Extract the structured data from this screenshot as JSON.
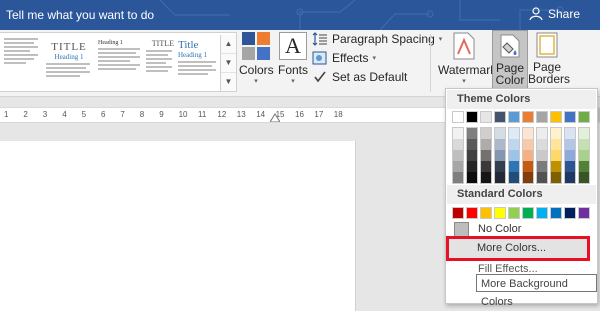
{
  "titlebar": {
    "tell_me": "Tell me what you want to do",
    "share_label": "Share"
  },
  "ribbon": {
    "style_thumbs": [
      {
        "title": "TITLE",
        "heading": "Heading 1"
      },
      {
        "title": "Heading 1",
        "heading": ""
      },
      {
        "title": "TITLE",
        "heading": ""
      },
      {
        "title": "Title",
        "heading": "Heading 1"
      }
    ],
    "colors_label": "Colors",
    "fonts_label": "Fonts",
    "fonts_glyph": "A",
    "paragraph_spacing_label": "Paragraph Spacing",
    "effects_label": "Effects",
    "set_default_label": "Set as Default",
    "watermark_label": "Watermark",
    "page_color_label": "Page Color",
    "page_borders_label": "Page Borders"
  },
  "ruler": {
    "ticks": [
      "1",
      "2",
      "3",
      "4",
      "5",
      "6",
      "7",
      "8",
      "9",
      "10",
      "11",
      "12",
      "13",
      "14",
      "15",
      "16",
      "17",
      "18"
    ]
  },
  "dropdown": {
    "theme_header": "Theme Colors",
    "theme_top": [
      "#ffffff",
      "#000000",
      "#e7e6e6",
      "#44546a",
      "#5b9bd5",
      "#ed7d31",
      "#a5a5a5",
      "#ffc000",
      "#4472c4",
      "#70ad47"
    ],
    "theme_shades": [
      [
        "#f2f2f2",
        "#d9d9d9",
        "#bfbfbf",
        "#a6a6a6",
        "#7f7f7f"
      ],
      [
        "#7f7f7f",
        "#595959",
        "#404040",
        "#262626",
        "#0d0d0d"
      ],
      [
        "#d0cece",
        "#aeabab",
        "#757171",
        "#3a3838",
        "#171616"
      ],
      [
        "#d6dce4",
        "#adb9ca",
        "#8497b0",
        "#333f4f",
        "#222a35"
      ],
      [
        "#deebf6",
        "#bdd7ee",
        "#9dc3e6",
        "#2e75b5",
        "#1f4e79"
      ],
      [
        "#fbe5d5",
        "#f7caac",
        "#f4b183",
        "#c55a11",
        "#833c0b"
      ],
      [
        "#ededed",
        "#dbdbdb",
        "#c9c9c9",
        "#7b7b7b",
        "#525252"
      ],
      [
        "#fff2cc",
        "#fee599",
        "#ffd965",
        "#bf9000",
        "#7f6000"
      ],
      [
        "#dae3f3",
        "#b4c6e7",
        "#8eaadb",
        "#2f5496",
        "#1f3864"
      ],
      [
        "#e2efd9",
        "#c5e0b3",
        "#a8d08d",
        "#538135",
        "#375623"
      ]
    ],
    "standard_header": "Standard Colors",
    "standard": [
      "#c00000",
      "#ff0000",
      "#ffc000",
      "#ffff00",
      "#92d050",
      "#00b050",
      "#00b0f0",
      "#0070c0",
      "#002060",
      "#7030a0"
    ],
    "no_color_label": "No Color",
    "more_colors_label": "More Colors...",
    "fill_effects_label": "Fill Effects...",
    "tooltip": "More Background Colors"
  }
}
